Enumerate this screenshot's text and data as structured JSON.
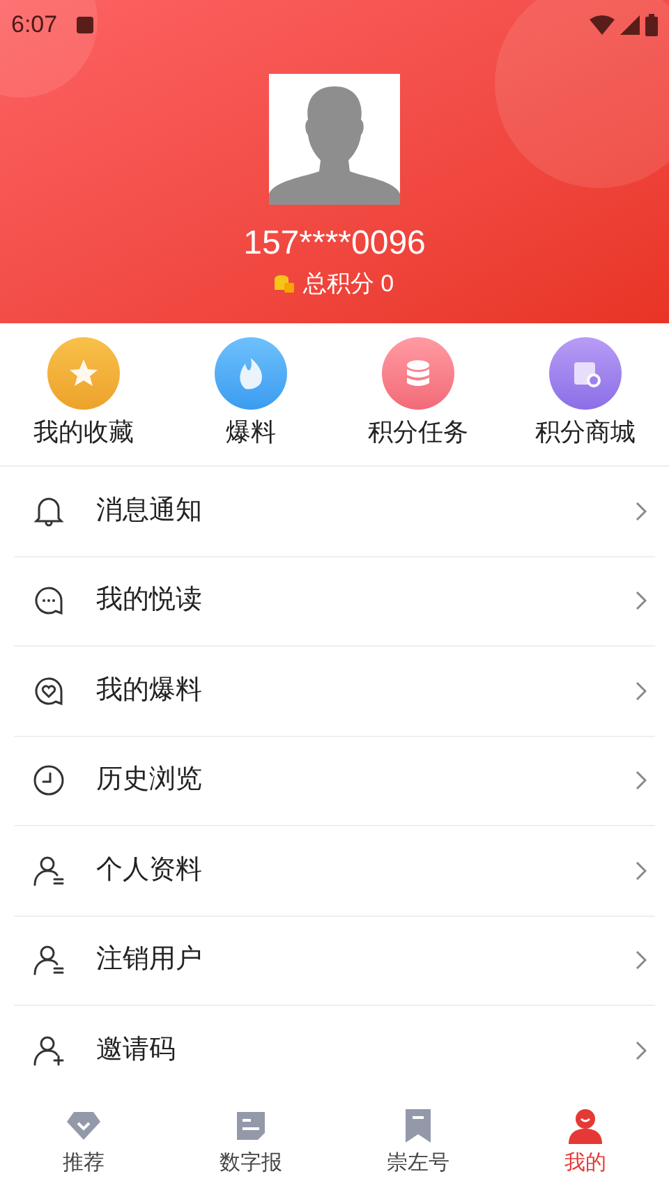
{
  "status_bar": {
    "time": "6:07"
  },
  "profile": {
    "phone": "157****0096",
    "points": "总积分 0"
  },
  "shortcuts": [
    {
      "kind": "star",
      "label": "我的收藏"
    },
    {
      "kind": "flame",
      "label": "爆料"
    },
    {
      "kind": "coins",
      "label": "积分任务"
    },
    {
      "kind": "shop",
      "label": "积分商城"
    }
  ],
  "menu": [
    {
      "kind": "bell",
      "label": "消息通知"
    },
    {
      "kind": "chat",
      "label": "我的悦读"
    },
    {
      "kind": "heart",
      "label": "我的爆料"
    },
    {
      "kind": "clock",
      "label": "历史浏览"
    },
    {
      "kind": "user",
      "label": "个人资料"
    },
    {
      "kind": "user",
      "label": "注销用户"
    },
    {
      "kind": "invite",
      "label": "邀请码"
    }
  ],
  "tabs": [
    {
      "kind": "diamond",
      "label": "推荐",
      "selected": false
    },
    {
      "kind": "paper",
      "label": "数字报",
      "selected": false
    },
    {
      "kind": "bookmark",
      "label": "崇左号",
      "selected": false
    },
    {
      "kind": "person",
      "label": "我的",
      "selected": true
    }
  ]
}
